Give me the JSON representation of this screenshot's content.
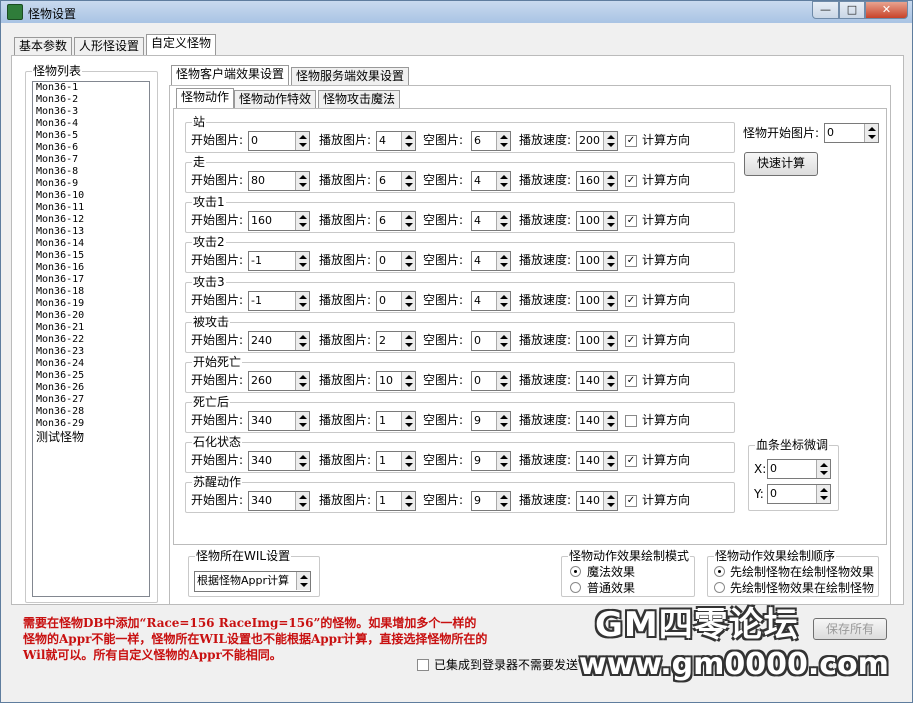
{
  "window": {
    "title": "怪物设置"
  },
  "main_tabs": [
    "基本参数",
    "人形怪设置",
    "自定义怪物"
  ],
  "monster_list": {
    "title": "怪物列表",
    "items": [
      "Mon36-1",
      "Mon36-2",
      "Mon36-3",
      "Mon36-4",
      "Mon36-5",
      "Mon36-6",
      "Mon36-7",
      "Mon36-8",
      "Mon36-9",
      "Mon36-10",
      "Mon36-11",
      "Mon36-12",
      "Mon36-13",
      "Mon36-14",
      "Mon36-15",
      "Mon36-16",
      "Mon36-17",
      "Mon36-18",
      "Mon36-19",
      "Mon36-20",
      "Mon36-21",
      "Mon36-22",
      "Mon36-23",
      "Mon36-24",
      "Mon36-25",
      "Mon36-26",
      "Mon36-27",
      "Mon36-28",
      "Mon36-29",
      "测试怪物"
    ]
  },
  "sub_tabs": [
    "怪物客户端效果设置",
    "怪物服务端效果设置"
  ],
  "inner_tabs": [
    "怪物动作",
    "怪物动作特效",
    "怪物攻击魔法"
  ],
  "field_labels": {
    "start": "开始图片:",
    "play": "播放图片:",
    "empty": "空图片:",
    "speed": "播放速度:",
    "dir": "计算方向"
  },
  "actions": [
    {
      "name": "站",
      "start": "0",
      "play": "4",
      "empty": "6",
      "speed": "200",
      "dir": true
    },
    {
      "name": "走",
      "start": "80",
      "play": "6",
      "empty": "4",
      "speed": "160",
      "dir": true
    },
    {
      "name": "攻击1",
      "start": "160",
      "play": "6",
      "empty": "4",
      "speed": "100",
      "dir": true
    },
    {
      "name": "攻击2",
      "start": "-1",
      "play": "0",
      "empty": "4",
      "speed": "100",
      "dir": true
    },
    {
      "name": "攻击3",
      "start": "-1",
      "play": "0",
      "empty": "4",
      "speed": "100",
      "dir": true
    },
    {
      "name": "被攻击",
      "start": "240",
      "play": "2",
      "empty": "0",
      "speed": "100",
      "dir": true
    },
    {
      "name": "开始死亡",
      "start": "260",
      "play": "10",
      "empty": "0",
      "speed": "140",
      "dir": true
    },
    {
      "name": "死亡后",
      "start": "340",
      "play": "1",
      "empty": "9",
      "speed": "140",
      "dir": false
    },
    {
      "name": "石化状态",
      "start": "340",
      "play": "1",
      "empty": "9",
      "speed": "140",
      "dir": true
    },
    {
      "name": "苏醒动作",
      "start": "340",
      "play": "1",
      "empty": "9",
      "speed": "140",
      "dir": true
    }
  ],
  "monster_start": {
    "label": "怪物开始图片:",
    "value": "0"
  },
  "quick_calc": "快速计算",
  "blood_bar": {
    "title": "血条坐标微调",
    "x_label": "X:",
    "x_value": "0",
    "y_label": "Y:",
    "y_value": "0"
  },
  "wil": {
    "title": "怪物所在WIL设置",
    "selected": "根据怪物Appr计算"
  },
  "draw_mode": {
    "title": "怪物动作效果绘制模式",
    "options": [
      "魔法效果",
      "普通效果"
    ],
    "selected": 0
  },
  "draw_order": {
    "title": "怪物动作效果绘制顺序",
    "options": [
      "先绘制怪物在绘制怪物效果",
      "先绘制怪物效果在绘制怪物"
    ],
    "selected": 0
  },
  "notice": [
    "需要在怪物DB中添加“Race=156 RaceImg=156”的怪物。如果增加多个一样的",
    "怪物的Appr不能一样，怪物所在WIL设置也不能根据Appr计算，直接选择怪物所在的",
    "Wil就可以。所有自定义怪物的Appr不能相同。"
  ],
  "integrate_checkbox": "已集成到登录器不需要发送",
  "save_all": "保存所有",
  "watermark": {
    "text": "GM四零论坛",
    "url": "www.gm0000.com"
  }
}
